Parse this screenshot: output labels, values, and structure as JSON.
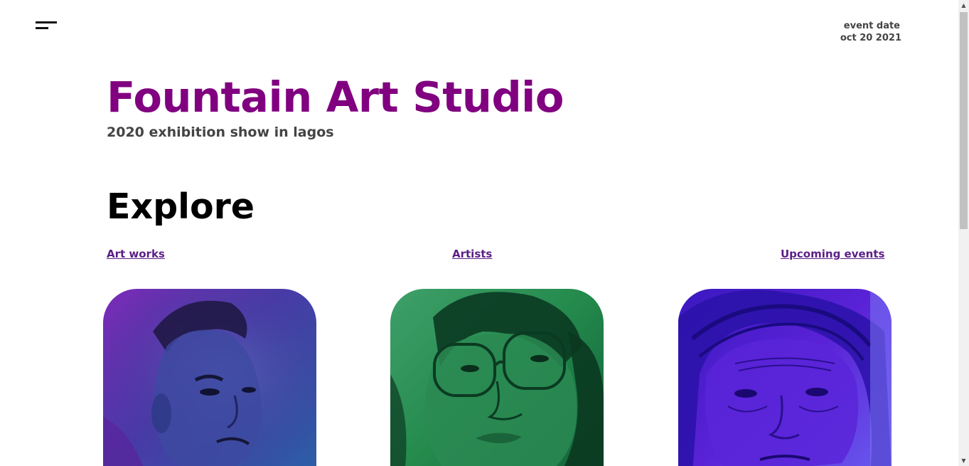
{
  "header": {
    "menu_icon": "hamburger-menu-icon",
    "event_date_label": "event date",
    "event_date_value": "oct 20 2021"
  },
  "hero": {
    "title": "Fountain Art Studio",
    "subtitle": "2020 exhibition show in lagos",
    "title_color": "#800080"
  },
  "explore": {
    "heading": "Explore",
    "links": [
      "Art works",
      "Artists",
      "Upcoming events"
    ],
    "link_color": "#5a1f86"
  },
  "cards": [
    {
      "subject": "portrait-man-purple-blue",
      "tint": "#5b3aa8"
    },
    {
      "subject": "portrait-man-glasses-green",
      "tint": "#248a4c"
    },
    {
      "subject": "portrait-elderly-woman-violet",
      "tint": "#4a1fd0"
    }
  ],
  "scrollbar": {
    "up_icon": "scroll-up-arrow-icon",
    "down_icon": "scroll-down-arrow-icon"
  }
}
